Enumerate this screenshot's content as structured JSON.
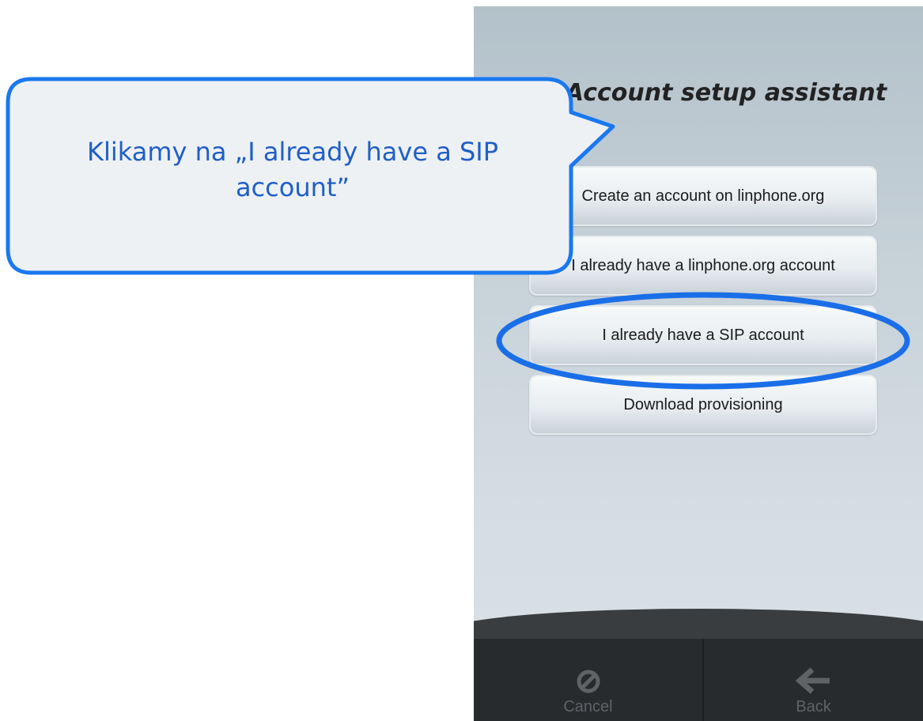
{
  "screen": {
    "title": "Account setup assistant"
  },
  "options": [
    {
      "label": "Create an account on linphone.org"
    },
    {
      "label": "I already have a linphone.org account"
    },
    {
      "label": "I already have a SIP account"
    },
    {
      "label": "Download provisioning"
    }
  ],
  "bottom_bar": {
    "cancel_label": "Cancel",
    "cancel_icon": "no-entry-icon",
    "back_label": "Back",
    "back_icon": "arrow-left-icon"
  },
  "annotation": {
    "callout_text_line1": "Klikamy na „I already have a SIP",
    "callout_text_line2": "account”",
    "callout_color": "#1f5fc7",
    "highlight_color": "#1a6ee8"
  }
}
